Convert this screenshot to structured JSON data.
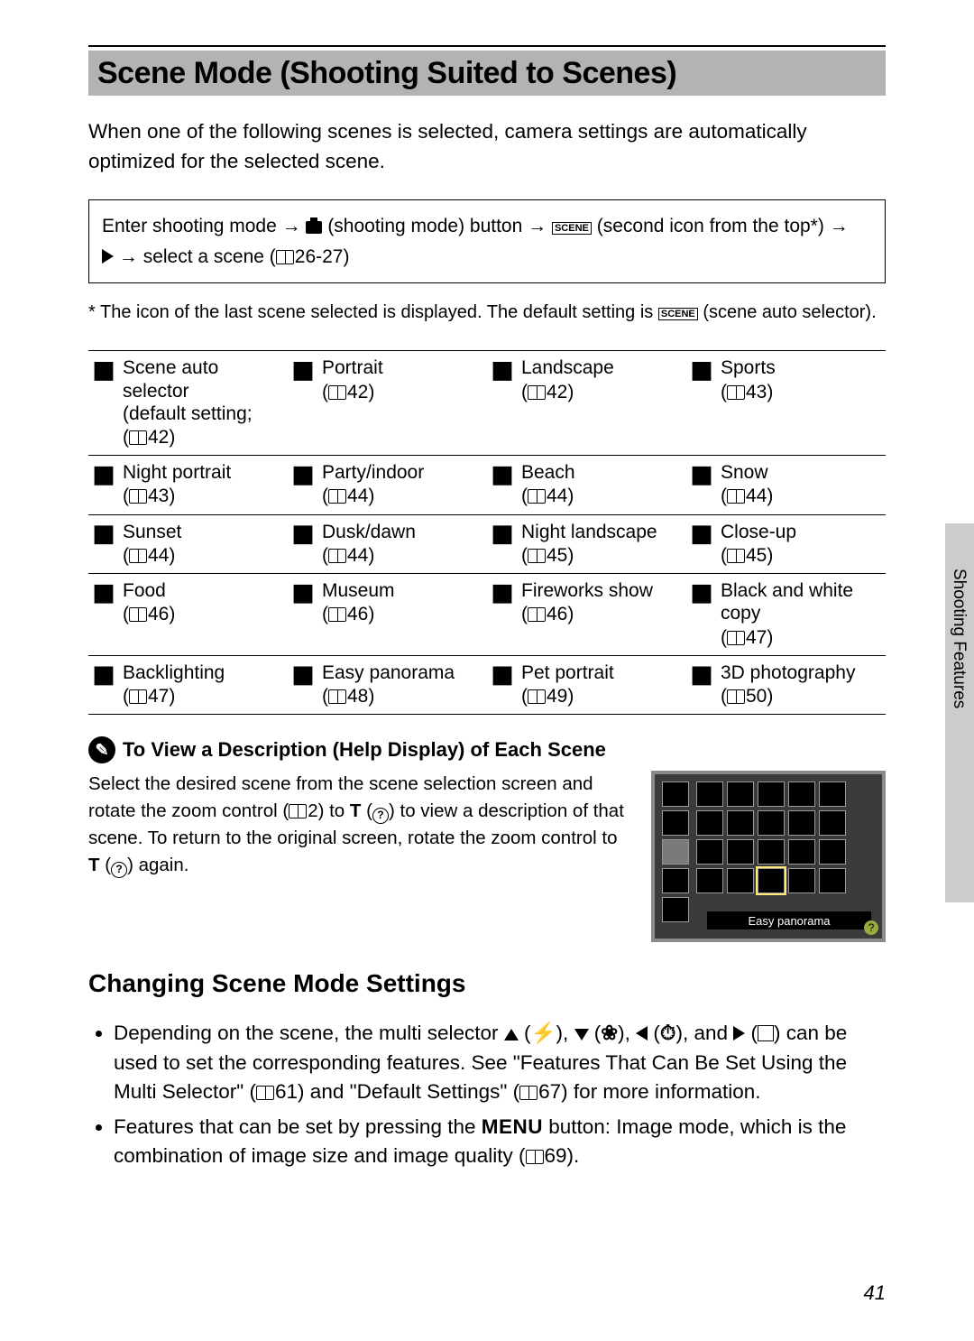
{
  "sidetab": "Shooting Features",
  "page_number": "41",
  "title": "Scene Mode (Shooting Suited to Scenes)",
  "intro": "When one of the following scenes is selected, camera settings are automatically optimized for the selected scene.",
  "nav": {
    "l1a": "Enter shooting mode ",
    "l1b": " (shooting mode) button ",
    "l1c": " (second icon from the top*) ",
    "l2": " select a scene (",
    "ref": "26-27)"
  },
  "footnote_pre": "*   The icon of the last scene selected is displayed. The default setting is ",
  "footnote_post": " (scene auto selector).",
  "scenes": [
    [
      {
        "name": "Scene auto selector",
        "sub": "(default setting;",
        "ref": "42)"
      },
      {
        "name": "Portrait",
        "ref": "42)"
      },
      {
        "name": "Landscape",
        "ref": "42)"
      },
      {
        "name": "Sports",
        "ref": "43)"
      }
    ],
    [
      {
        "name": "Night portrait",
        "ref": "43)"
      },
      {
        "name": "Party/indoor",
        "ref": "44)"
      },
      {
        "name": "Beach",
        "ref": "44)"
      },
      {
        "name": "Snow",
        "ref": "44)"
      }
    ],
    [
      {
        "name": "Sunset",
        "ref": "44)"
      },
      {
        "name": "Dusk/dawn",
        "ref": "44)"
      },
      {
        "name": "Night landscape",
        "ref": "45)"
      },
      {
        "name": "Close-up",
        "ref": "45)"
      }
    ],
    [
      {
        "name": "Food",
        "ref": "46)"
      },
      {
        "name": "Museum",
        "ref": "46)"
      },
      {
        "name": "Fireworks show",
        "ref": "46)"
      },
      {
        "name": "Black and white copy",
        "ref": "47)"
      }
    ],
    [
      {
        "name": "Backlighting",
        "ref": "47)"
      },
      {
        "name": "Easy panorama",
        "ref": "48)"
      },
      {
        "name": "Pet portrait",
        "ref": "49)"
      },
      {
        "name": "3D photography",
        "ref": "50)"
      }
    ]
  ],
  "help_heading": "To View a Description (Help Display) of Each Scene",
  "help_text_1": "Select the desired scene from the scene selection screen and rotate the zoom control (",
  "help_ref1": "2) to ",
  "help_text_2": " to view a description of that scene. To return to the original screen, rotate the zoom control to ",
  "help_text_3": " again.",
  "cam_label": "Easy panorama",
  "section2": "Changing Scene Mode Settings",
  "b1a": "Depending on the scene, the multi selector ",
  "b1b": " can be used to set the corresponding features. See \"Features That Can Be Set Using the Multi Selector\" (",
  "b1c": "61) and \"Default Settings\" (",
  "b1d": "67) for more information.",
  "b2a": "Features that can be set by pressing the ",
  "b2menu": "MENU",
  "b2b": " button: Image mode, which is the combination of image size and image quality (",
  "b2c": "69).",
  "T": "T",
  "and": ", and "
}
